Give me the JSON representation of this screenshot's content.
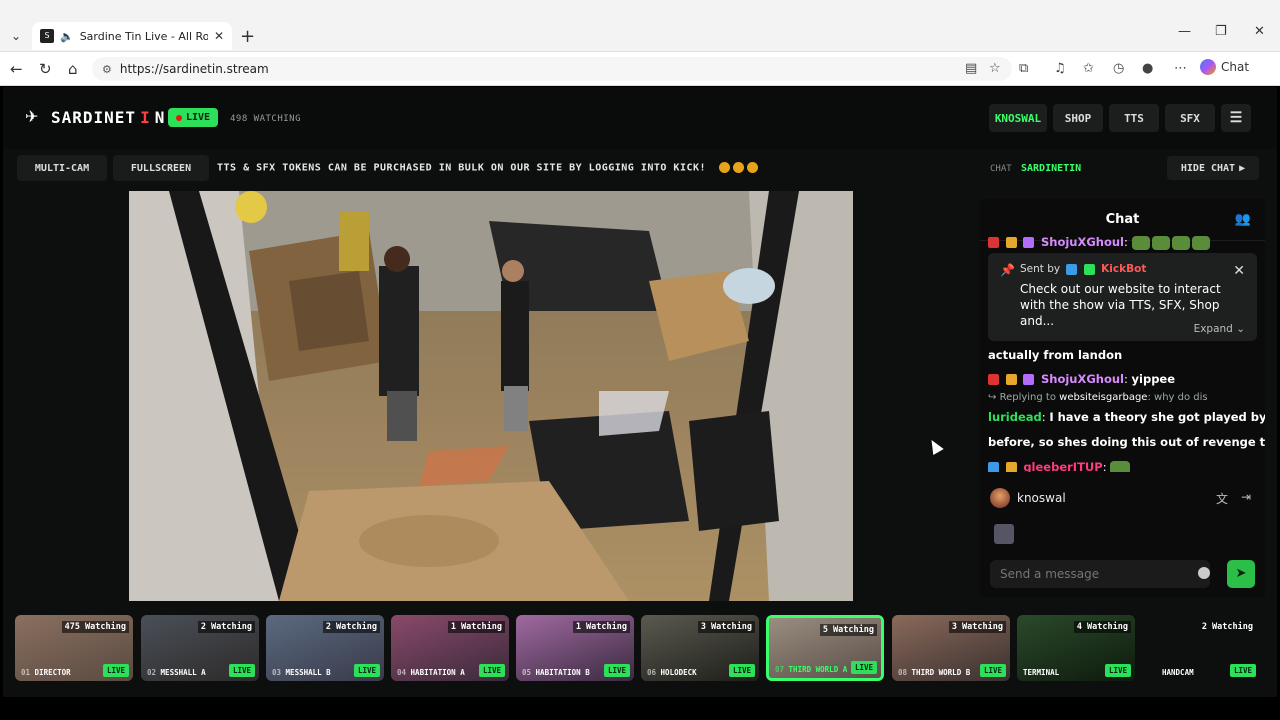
{
  "browser": {
    "tab_title": "Sardine Tin Live - All Rooms, A",
    "url": "https://sardinetin.stream",
    "chat_label": "Chat"
  },
  "site": {
    "logo_text": "SARDINET",
    "logo_letter_i": "I",
    "logo_letter_n": "N",
    "live_label": "LIVE",
    "watching_text": "498 WATCHING",
    "nav": {
      "user": "KNOSWAL",
      "shop": "SHOP",
      "tts": "TTS",
      "sfx": "SFX"
    },
    "subbar": {
      "multicam": "MULTI-CAM",
      "fullscreen": "FULLSCREEN",
      "ticker": "TTS & SFX TOKENS CAN BE PURCHASED IN BULK ON OUR SITE BY LOGGING INTO KICK!"
    }
  },
  "chat": {
    "label": "CHAT",
    "room": "SARDINETIN",
    "hide_label": "HIDE CHAT",
    "title": "Chat",
    "top_user": "ShojuXGhoul",
    "pinned": {
      "sent_by": "Sent by",
      "bot": "KickBot",
      "text": "Check out our website to interact with the show via TTS, SFX, Shop and...",
      "expand": "Expand"
    },
    "messages": [
      {
        "text": "actually from landon"
      },
      {
        "user": "ShojuXGhoul",
        "text": "yippee",
        "color": "#d88bff"
      },
      {
        "reply_prefix": "Replying to",
        "reply_user": "websiteisgarbage",
        "reply_text": "why do dis"
      },
      {
        "user": "luridead",
        "text": "I have a theory she got played by a guy",
        "color": "#2de05a"
      },
      {
        "text": "before, so shes doing this out of revenge to men"
      },
      {
        "user": "gleeberITUP",
        "color": "#ff3b7a"
      }
    ],
    "me": "knoswal",
    "input_placeholder": "Send a message"
  },
  "cameras": [
    {
      "name": "DIRECTOR",
      "num": "01",
      "watching": "475 Watching",
      "live": "LIVE",
      "active": false
    },
    {
      "name": "MESSHALL A",
      "num": "02",
      "watching": "2 Watching",
      "live": "LIVE",
      "active": false
    },
    {
      "name": "MESSHALL B",
      "num": "03",
      "watching": "2 Watching",
      "live": "LIVE",
      "active": false
    },
    {
      "name": "HABITATION A",
      "num": "04",
      "watching": "1 Watching",
      "live": "LIVE",
      "active": false
    },
    {
      "name": "HABITATION B",
      "num": "05",
      "watching": "1 Watching",
      "live": "LIVE",
      "active": false
    },
    {
      "name": "HOLODECK",
      "num": "06",
      "watching": "3 Watching",
      "live": "LIVE",
      "active": false
    },
    {
      "name": "THIRD WORLD A",
      "num": "07",
      "watching": "5 Watching",
      "live": "LIVE",
      "active": true
    },
    {
      "name": "THIRD WORLD B",
      "num": "08",
      "watching": "3 Watching",
      "live": "LIVE",
      "active": false
    },
    {
      "name": "TERMINAL",
      "num": "",
      "watching": "4 Watching",
      "live": "LIVE",
      "active": false
    },
    {
      "name": "HANDCAM",
      "num": "",
      "watching": "2 Watching",
      "live": "LIVE",
      "active": false
    }
  ],
  "colors": {
    "accent": "#39ff6a",
    "live": "#2de05a",
    "bot": "#ff5a5a"
  }
}
